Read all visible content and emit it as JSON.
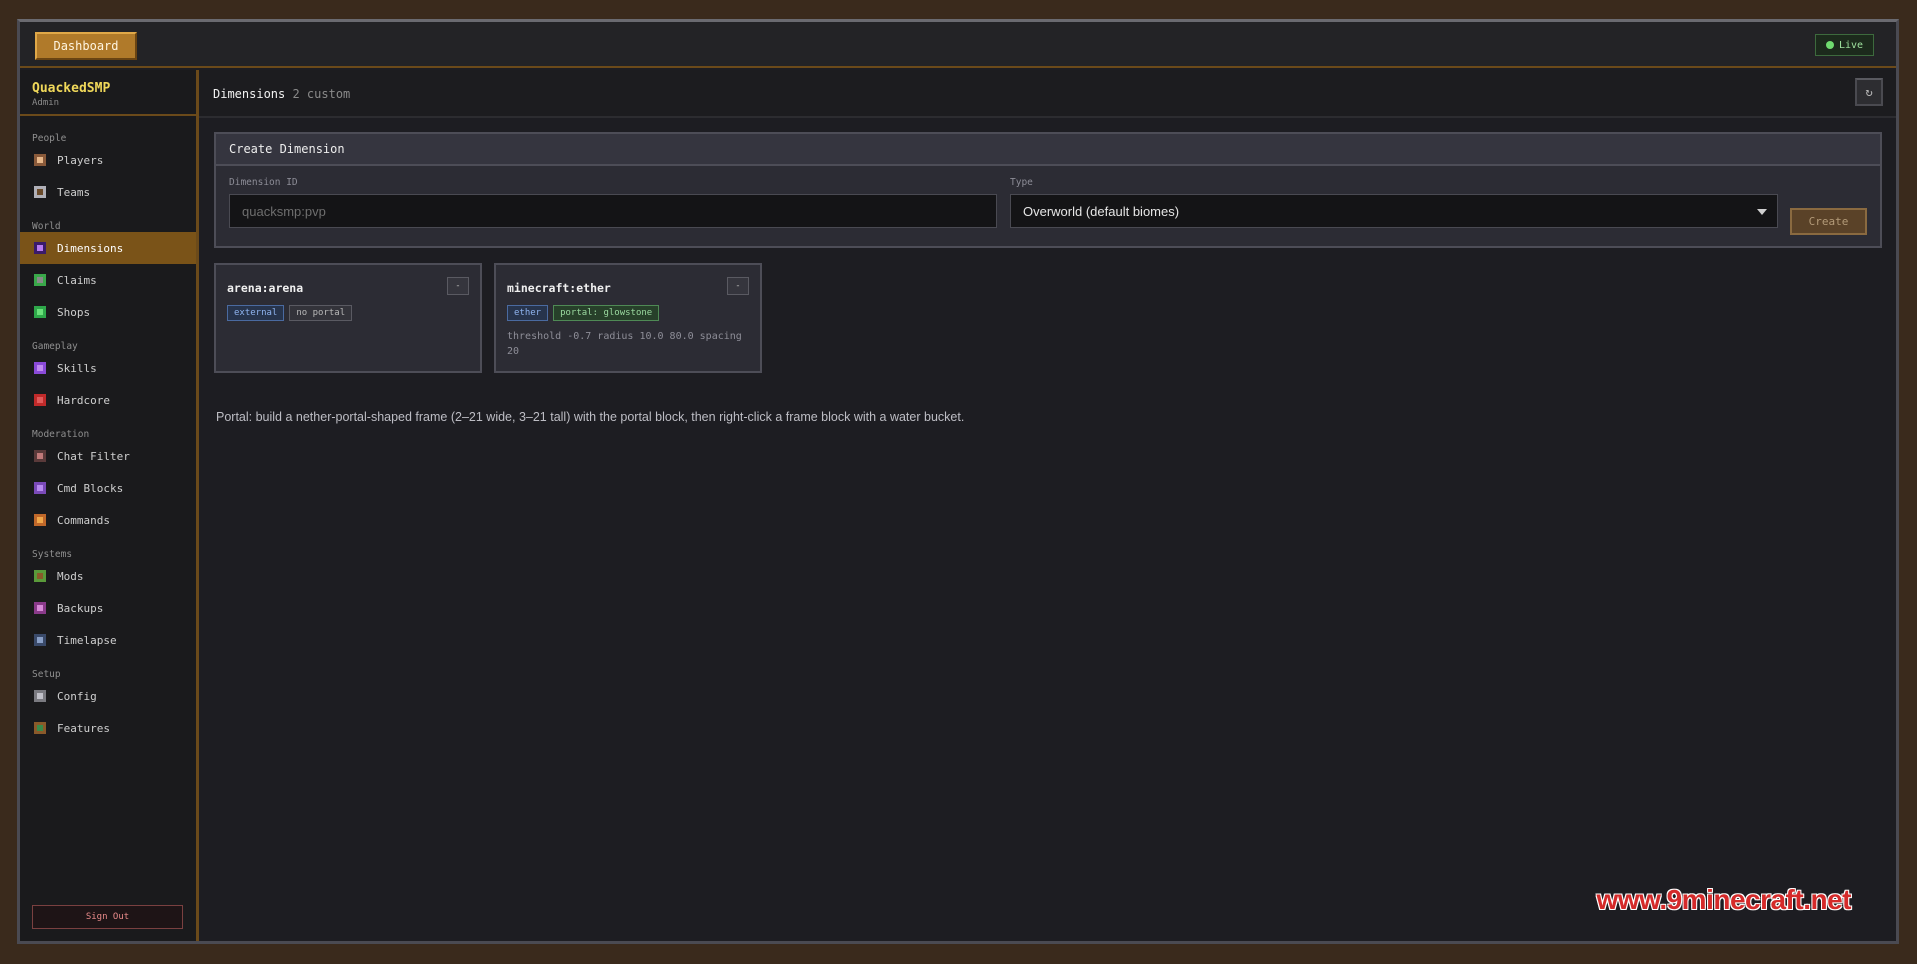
{
  "topbar": {
    "dashboard_label": "Dashboard",
    "live_label": "Live"
  },
  "brand": {
    "name": "QuackedSMP",
    "role": "Admin"
  },
  "sidebar": {
    "sections": [
      {
        "label": "People",
        "items": [
          {
            "label": "Players",
            "icon": "player-head-icon"
          },
          {
            "label": "Teams",
            "icon": "sword-icon"
          }
        ]
      },
      {
        "label": "World",
        "items": [
          {
            "label": "Dimensions",
            "icon": "portal-icon",
            "active": true
          },
          {
            "label": "Claims",
            "icon": "flag-icon"
          },
          {
            "label": "Shops",
            "icon": "emerald-icon"
          }
        ]
      },
      {
        "label": "Gameplay",
        "items": [
          {
            "label": "Skills",
            "icon": "skills-icon"
          },
          {
            "label": "Hardcore",
            "icon": "heart-icon"
          }
        ]
      },
      {
        "label": "Moderation",
        "items": [
          {
            "label": "Chat Filter",
            "icon": "chat-filter-icon"
          },
          {
            "label": "Cmd Blocks",
            "icon": "command-block-icon"
          },
          {
            "label": "Commands",
            "icon": "commands-icon"
          }
        ]
      },
      {
        "label": "Systems",
        "items": [
          {
            "label": "Mods",
            "icon": "grass-block-icon"
          },
          {
            "label": "Backups",
            "icon": "chest-icon"
          },
          {
            "label": "Timelapse",
            "icon": "camera-icon"
          }
        ]
      },
      {
        "label": "Setup",
        "items": [
          {
            "label": "Config",
            "icon": "gear-icon"
          },
          {
            "label": "Features",
            "icon": "bookshelf-icon"
          }
        ]
      }
    ],
    "sign_out_label": "Sign Out"
  },
  "main": {
    "title": "Dimensions",
    "subtitle": "2 custom",
    "refresh_icon": "↻"
  },
  "create": {
    "heading": "Create Dimension",
    "id_label": "Dimension ID",
    "id_placeholder": "quacksmp:pvp",
    "type_label": "Type",
    "type_value": "Overworld (default biomes)",
    "create_label": "Create"
  },
  "dimensions": [
    {
      "name": "arena:arena",
      "remove_label": "-",
      "tags": [
        {
          "label": "external",
          "color": "blue"
        },
        {
          "label": "no portal",
          "color": "grey"
        }
      ],
      "detail": ""
    },
    {
      "name": "minecraft:ether",
      "remove_label": "-",
      "tags": [
        {
          "label": "ether",
          "color": "blue"
        },
        {
          "label": "portal: glowstone",
          "color": "green"
        }
      ],
      "detail": "threshold -0.7 radius 10.0 80.0 spacing 20"
    }
  ],
  "portal_note": "Portal: build a nether-portal-shaped frame (2–21 wide, 3–21 tall) with the portal block, then right-click a frame block with a water bucket.",
  "watermark": "www.9minecraft.net",
  "colors": {
    "accent": "#b07a2a",
    "active_nav": "#7a5318",
    "brand": "#f0d85a",
    "live": "#6fdc6f"
  }
}
